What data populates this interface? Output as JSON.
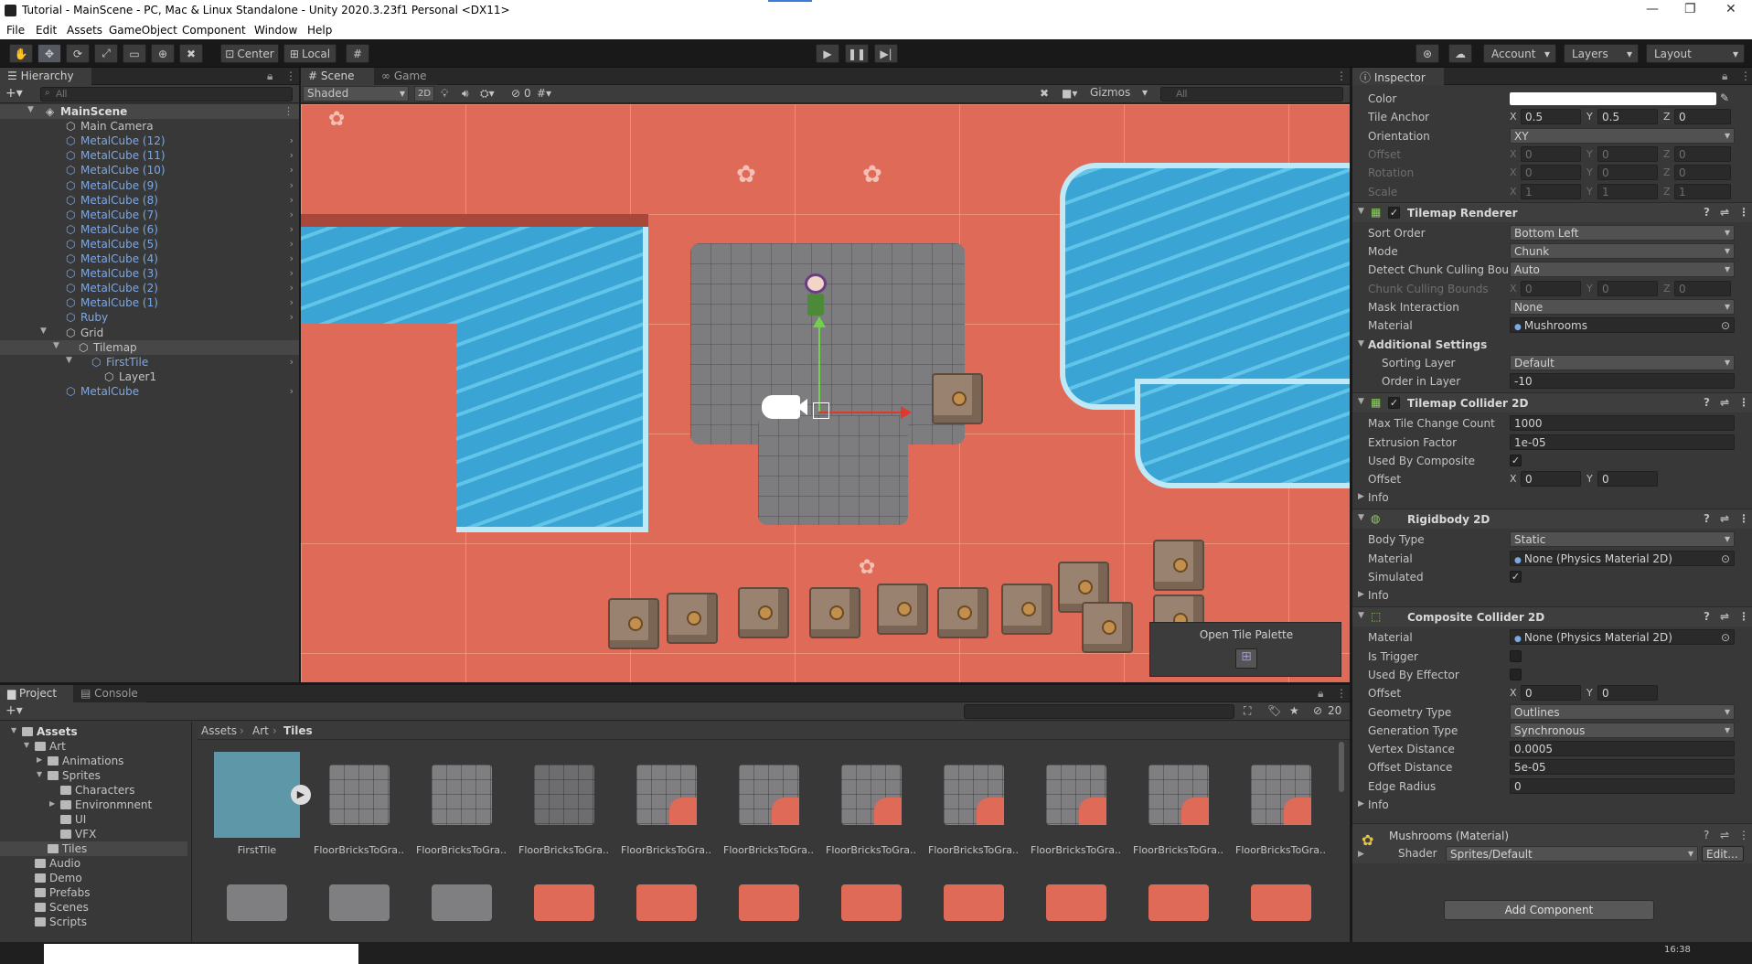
{
  "window": {
    "title": "Tutorial - MainScene - PC, Mac & Linux Standalone - Unity 2020.3.23f1 Personal <DX11>",
    "min": "—",
    "max": "❐",
    "close": "✕"
  },
  "menu": [
    "File",
    "Edit",
    "Assets",
    "GameObject",
    "Component",
    "Window",
    "Help"
  ],
  "toolbar": {
    "pivot": "Center",
    "space": "Local",
    "account": "Account",
    "layers": "Layers",
    "layout": "Layout"
  },
  "hierarchy": {
    "tab": "Hierarchy",
    "search_placeholder": "All",
    "items": [
      {
        "label": "MainScene",
        "indent": 0,
        "type": "scene"
      },
      {
        "label": "Main Camera",
        "indent": 1,
        "type": "obj"
      },
      {
        "label": "MetalCube (12)",
        "indent": 1,
        "type": "prefab"
      },
      {
        "label": "MetalCube (11)",
        "indent": 1,
        "type": "prefab"
      },
      {
        "label": "MetalCube (10)",
        "indent": 1,
        "type": "prefab"
      },
      {
        "label": "MetalCube (9)",
        "indent": 1,
        "type": "prefab"
      },
      {
        "label": "MetalCube (8)",
        "indent": 1,
        "type": "prefab"
      },
      {
        "label": "MetalCube (7)",
        "indent": 1,
        "type": "prefab"
      },
      {
        "label": "MetalCube (6)",
        "indent": 1,
        "type": "prefab"
      },
      {
        "label": "MetalCube (5)",
        "indent": 1,
        "type": "prefab"
      },
      {
        "label": "MetalCube (4)",
        "indent": 1,
        "type": "prefab"
      },
      {
        "label": "MetalCube (3)",
        "indent": 1,
        "type": "prefab"
      },
      {
        "label": "MetalCube (2)",
        "indent": 1,
        "type": "prefab"
      },
      {
        "label": "MetalCube (1)",
        "indent": 1,
        "type": "prefab"
      },
      {
        "label": "Ruby",
        "indent": 1,
        "type": "prefab"
      },
      {
        "label": "Grid",
        "indent": 1,
        "type": "obj"
      },
      {
        "label": "Tilemap",
        "indent": 2,
        "type": "obj"
      },
      {
        "label": "FirstTile",
        "indent": 3,
        "type": "prefab"
      },
      {
        "label": "Layer1",
        "indent": 4,
        "type": "obj"
      },
      {
        "label": "MetalCube",
        "indent": 1,
        "type": "prefab"
      }
    ]
  },
  "scene": {
    "tab_scene": "Scene",
    "tab_game": "Game",
    "shading": "Shaded",
    "mode2d": "2D",
    "hidden_count": "0",
    "gizmos": "Gizmos",
    "search_placeholder": "All",
    "overlay_label": "Open Tile Palette"
  },
  "inspector": {
    "tab": "Inspector",
    "top_rows": [
      {
        "label": "Color",
        "kind": "color"
      },
      {
        "label": "Tile Anchor",
        "kind": "xyz",
        "x": "0.5",
        "y": "0.5",
        "z": "0"
      },
      {
        "label": "Orientation",
        "kind": "dd",
        "value": "XY"
      },
      {
        "label": "Offset",
        "kind": "xyz",
        "x": "0",
        "y": "0",
        "z": "0",
        "dim": true
      },
      {
        "label": "Rotation",
        "kind": "xyz",
        "x": "0",
        "y": "0",
        "z": "0",
        "dim": true
      },
      {
        "label": "Scale",
        "kind": "xyz",
        "x": "1",
        "y": "1",
        "z": "1",
        "dim": true
      }
    ],
    "tilemap_renderer": {
      "title": "Tilemap Renderer",
      "rows": [
        {
          "label": "Sort Order",
          "kind": "dd",
          "value": "Bottom Left"
        },
        {
          "label": "Mode",
          "kind": "dd",
          "value": "Chunk"
        },
        {
          "label": "Detect Chunk Culling Bound",
          "kind": "dd",
          "value": "Auto"
        },
        {
          "label": "Chunk Culling Bounds",
          "kind": "xyz",
          "x": "0",
          "y": "0",
          "z": "0",
          "dim": true
        },
        {
          "label": "Mask Interaction",
          "kind": "dd",
          "value": "None"
        },
        {
          "label": "Material",
          "kind": "obj",
          "value": "Mushrooms"
        }
      ],
      "additional": "Additional Settings",
      "sub_rows": [
        {
          "label": "Sorting Layer",
          "kind": "dd",
          "value": "Default"
        },
        {
          "label": "Order in Layer",
          "kind": "txt",
          "value": "-10"
        }
      ]
    },
    "tilemap_collider": {
      "title": "Tilemap Collider 2D",
      "rows": [
        {
          "label": "Max Tile Change Count",
          "kind": "txt",
          "value": "1000"
        },
        {
          "label": "Extrusion Factor",
          "kind": "txt",
          "value": "1e-05"
        },
        {
          "label": "Used By Composite",
          "kind": "check",
          "checked": true
        },
        {
          "label": "Offset",
          "kind": "xy",
          "x": "0",
          "y": "0"
        }
      ],
      "info": "Info"
    },
    "rigidbody": {
      "title": "Rigidbody 2D",
      "rows": [
        {
          "label": "Body Type",
          "kind": "dd",
          "value": "Static"
        },
        {
          "label": "Material",
          "kind": "obj",
          "value": "None (Physics Material 2D)"
        },
        {
          "label": "Simulated",
          "kind": "check",
          "checked": true
        }
      ],
      "info": "Info"
    },
    "composite": {
      "title": "Composite Collider 2D",
      "rows": [
        {
          "label": "Material",
          "kind": "obj",
          "value": "None (Physics Material 2D)"
        },
        {
          "label": "Is Trigger",
          "kind": "check",
          "checked": false
        },
        {
          "label": "Used By Effector",
          "kind": "check",
          "checked": false
        },
        {
          "label": "Offset",
          "kind": "xy",
          "x": "0",
          "y": "0"
        },
        {
          "label": "Geometry Type",
          "kind": "dd",
          "value": "Outlines"
        },
        {
          "label": "Generation Type",
          "kind": "dd",
          "value": "Synchronous"
        },
        {
          "label": "Vertex Distance",
          "kind": "txt",
          "value": "0.0005"
        },
        {
          "label": "Offset Distance",
          "kind": "txt",
          "value": "5e-05"
        },
        {
          "label": "Edge Radius",
          "kind": "txt",
          "value": "0"
        }
      ],
      "info": "Info"
    },
    "material": {
      "title": "Mushrooms (Material)",
      "shader_label": "Shader",
      "shader_value": "Sprites/Default",
      "edit": "Edit..."
    },
    "add_component": "Add Component"
  },
  "project": {
    "tab_project": "Project",
    "tab_console": "Console",
    "hidden_count": "20",
    "breadcrumb": [
      "Assets",
      "Art",
      "Tiles"
    ],
    "folders": [
      {
        "label": "Assets",
        "indent": 0,
        "bold": true
      },
      {
        "label": "Art",
        "indent": 1
      },
      {
        "label": "Animations",
        "indent": 2
      },
      {
        "label": "Sprites",
        "indent": 2
      },
      {
        "label": "Characters",
        "indent": 3
      },
      {
        "label": "Environmnent",
        "indent": 3
      },
      {
        "label": "UI",
        "indent": 3
      },
      {
        "label": "VFX",
        "indent": 3
      },
      {
        "label": "Tiles",
        "indent": 2,
        "selected": true
      },
      {
        "label": "Audio",
        "indent": 1
      },
      {
        "label": "Demo",
        "indent": 1
      },
      {
        "label": "Prefabs",
        "indent": 1
      },
      {
        "label": "Scenes",
        "indent": 1
      },
      {
        "label": "Scripts",
        "indent": 1
      }
    ],
    "assets": [
      "FirstTile",
      "FloorBricksToGra...",
      "FloorBricksToGra...",
      "FloorBricksToGra...",
      "FloorBricksToGra...",
      "FloorBricksToGra...",
      "FloorBricksToGra...",
      "FloorBricksToGra...",
      "FloorBricksToGra...",
      "FloorBricksToGra...",
      "FloorBricksToGra..."
    ]
  },
  "taskbar": {
    "time": "16:38"
  }
}
